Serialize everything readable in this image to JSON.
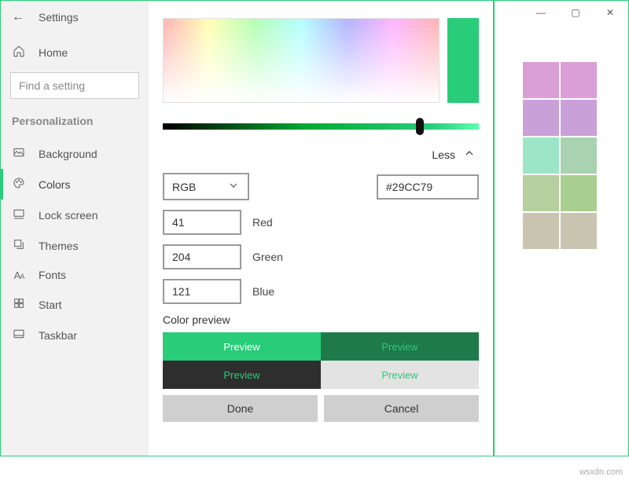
{
  "titlebar": {
    "min": "—",
    "max": "▢",
    "close": "✕"
  },
  "sidebar": {
    "back_icon": "←",
    "title": "Settings",
    "home": "Home",
    "search_placeholder": "Find a setting",
    "section": "Personalization",
    "items": [
      {
        "label": "Background"
      },
      {
        "label": "Colors"
      },
      {
        "label": "Lock screen"
      },
      {
        "label": "Themes"
      },
      {
        "label": "Fonts"
      },
      {
        "label": "Start"
      },
      {
        "label": "Taskbar"
      }
    ]
  },
  "picker": {
    "less_label": "Less",
    "mode": "RGB",
    "hex": "#29CC79",
    "r": "41",
    "r_label": "Red",
    "g": "204",
    "g_label": "Green",
    "b": "121",
    "b_label": "Blue",
    "preview_title": "Color preview",
    "preview_label": "Preview",
    "done": "Done",
    "cancel": "Cancel",
    "current_color": "#29CC79"
  },
  "swatches": [
    "#d99fd6",
    "#d99fd6",
    "#caa0d8",
    "#caa0d8",
    "#9ce6c7",
    "#a9d2b0",
    "#b5cf9e",
    "#a9cf90",
    "#c9c4af",
    "#c9c4af"
  ],
  "watermark": "wsxdn.com"
}
